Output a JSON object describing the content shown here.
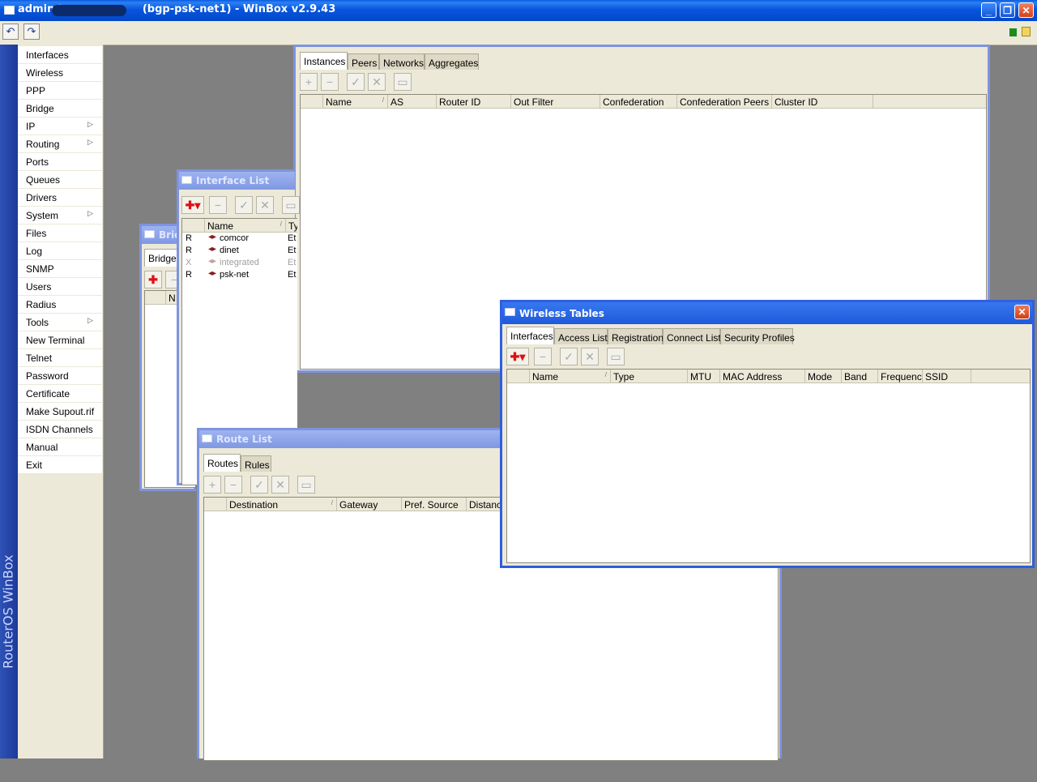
{
  "app": {
    "title": "admin@        (bgp-psk-net1) - WinBox v2.9.43",
    "side_label": "RouterOS WinBox"
  },
  "toolbar": {
    "undo_icon": "undo-icon",
    "redo_icon": "redo-icon"
  },
  "menu": {
    "items": [
      {
        "label": "Interfaces",
        "submenu": false
      },
      {
        "label": "Wireless",
        "submenu": false
      },
      {
        "label": "PPP",
        "submenu": false
      },
      {
        "label": "Bridge",
        "submenu": false
      },
      {
        "label": "IP",
        "submenu": true
      },
      {
        "label": "Routing",
        "submenu": true
      },
      {
        "label": "Ports",
        "submenu": false
      },
      {
        "label": "Queues",
        "submenu": false
      },
      {
        "label": "Drivers",
        "submenu": false
      },
      {
        "label": "System",
        "submenu": true
      },
      {
        "label": "Files",
        "submenu": false
      },
      {
        "label": "Log",
        "submenu": false
      },
      {
        "label": "SNMP",
        "submenu": false
      },
      {
        "label": "Users",
        "submenu": false
      },
      {
        "label": "Radius",
        "submenu": false
      },
      {
        "label": "Tools",
        "submenu": true
      },
      {
        "label": "New Terminal",
        "submenu": false
      },
      {
        "label": "Telnet",
        "submenu": false
      },
      {
        "label": "Password",
        "submenu": false
      },
      {
        "label": "Certificate",
        "submenu": false
      },
      {
        "label": "Make Supout.rif",
        "submenu": false
      },
      {
        "label": "ISDN Channels",
        "submenu": false
      },
      {
        "label": "Manual",
        "submenu": false
      },
      {
        "label": "Exit",
        "submenu": false
      }
    ]
  },
  "bridge_window": {
    "title": "Brid",
    "tab": "Bridges",
    "col_name": "N"
  },
  "interface_window": {
    "title": "Interface List",
    "columns": [
      "Name",
      "Ty"
    ],
    "rows": [
      {
        "flag": "R",
        "name": "comcor",
        "type": "Et",
        "disabled": false
      },
      {
        "flag": "R",
        "name": "dinet",
        "type": "Et",
        "disabled": false
      },
      {
        "flag": "X",
        "name": "integrated",
        "type": "Et",
        "disabled": true
      },
      {
        "flag": "R",
        "name": "psk-net",
        "type": "Et",
        "disabled": false
      }
    ]
  },
  "bgp_window": {
    "tabs": [
      "Instances",
      "Peers",
      "Networks",
      "Aggregates"
    ],
    "columns": [
      "Name",
      "AS",
      "Router ID",
      "Out Filter",
      "Confederation",
      "Confederation Peers",
      "Cluster ID"
    ]
  },
  "route_window": {
    "title": "Route List",
    "tabs": [
      "Routes",
      "Rules"
    ],
    "columns": [
      "Destination",
      "Gateway",
      "Pref. Source",
      "Distance"
    ]
  },
  "wireless_window": {
    "title": "Wireless Tables",
    "tabs": [
      "Interfaces",
      "Access List",
      "Registration",
      "Connect List",
      "Security Profiles"
    ],
    "columns": [
      "Name",
      "Type",
      "MTU",
      "MAC Address",
      "Mode",
      "Band",
      "Frequency",
      "SSID"
    ]
  }
}
